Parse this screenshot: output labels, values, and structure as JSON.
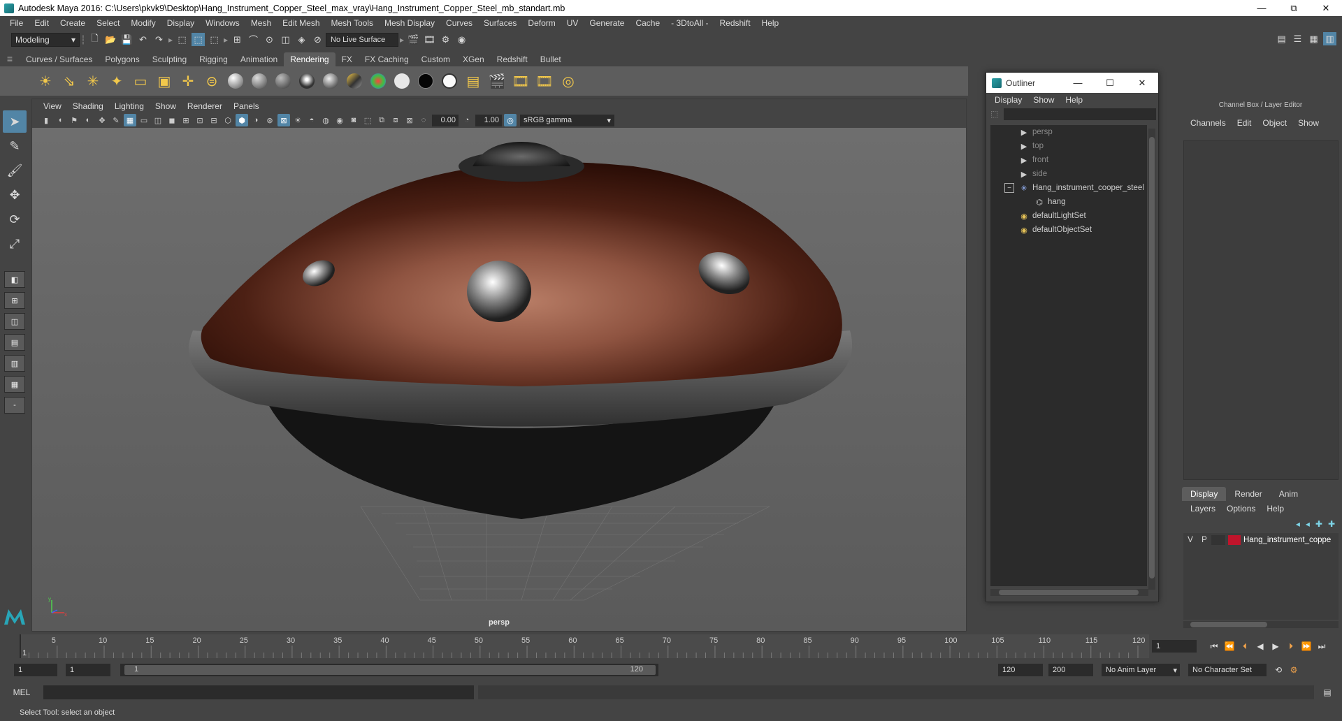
{
  "window": {
    "title": "Autodesk Maya 2016: C:\\Users\\pkvk9\\Desktop\\Hang_Instrument_Copper_Steel_max_vray\\Hang_Instrument_Copper_Steel_mb_standart.mb",
    "minimize_glyph": "—",
    "maximize_glyph": "⧉",
    "close_glyph": "✕"
  },
  "main_menu": [
    "File",
    "Edit",
    "Create",
    "Select",
    "Modify",
    "Display",
    "Windows",
    "Mesh",
    "Edit Mesh",
    "Mesh Tools",
    "Mesh Display",
    "Curves",
    "Surfaces",
    "Deform",
    "UV",
    "Generate",
    "Cache",
    "- 3DtoAll -",
    "Redshift",
    "Help"
  ],
  "status_line": {
    "mode": "Modeling",
    "live_surface": "No Live Surface"
  },
  "shelf": {
    "tabs": [
      "Curves / Surfaces",
      "Polygons",
      "Sculpting",
      "Rigging",
      "Animation",
      "Rendering",
      "FX",
      "FX Caching",
      "Custom",
      "XGen",
      "Redshift",
      "Bullet"
    ],
    "active_tab": "Rendering"
  },
  "viewport": {
    "menu": [
      "View",
      "Shading",
      "Lighting",
      "Show",
      "Renderer",
      "Panels"
    ],
    "exposure": "0.00",
    "gamma_value": "1.00",
    "color_space": "sRGB gamma",
    "camera_label": "persp",
    "axis_y": "y",
    "axis_x": "x"
  },
  "outliner": {
    "title": "Outliner",
    "menu": [
      "Display",
      "Show",
      "Help"
    ],
    "items": [
      {
        "label": "persp",
        "icon": "camera-icon",
        "dim": true,
        "indent": 1
      },
      {
        "label": "top",
        "icon": "camera-icon",
        "dim": true,
        "indent": 1
      },
      {
        "label": "front",
        "icon": "camera-icon",
        "dim": true,
        "indent": 1
      },
      {
        "label": "side",
        "icon": "camera-icon",
        "dim": true,
        "indent": 1
      },
      {
        "label": "Hang_instrument_cooper_steel",
        "icon": "group-icon",
        "dim": false,
        "indent": 1,
        "expander": "−"
      },
      {
        "label": "hang",
        "icon": "mesh-icon",
        "dim": false,
        "indent": 2
      },
      {
        "label": "defaultLightSet",
        "icon": "set-icon",
        "dim": false,
        "indent": 1
      },
      {
        "label": "defaultObjectSet",
        "icon": "set-icon",
        "dim": false,
        "indent": 1
      }
    ]
  },
  "channel_box": {
    "title": "Channel Box / Layer Editor",
    "menu": [
      "Channels",
      "Edit",
      "Object",
      "Show"
    ],
    "layer_tabs": [
      "Display",
      "Render",
      "Anim"
    ],
    "active_layer_tab": "Display",
    "layer_menu": [
      "Layers",
      "Options",
      "Help"
    ],
    "layers": [
      {
        "v": "V",
        "p": "P",
        "name": "Hang_instrument_coppe",
        "color": "#c0142b"
      }
    ]
  },
  "timeline": {
    "start_label": "1",
    "ticks": [
      5,
      10,
      15,
      20,
      25,
      30,
      35,
      40,
      45,
      50,
      55,
      60,
      65,
      70,
      75,
      80,
      85,
      90,
      95,
      100,
      105,
      110,
      115,
      120
    ],
    "min": 1,
    "max": 120,
    "current_frame": "1"
  },
  "range": {
    "start": "1",
    "playback_start": "1",
    "slider_start": "1",
    "slider_end": "120",
    "playback_end": "120",
    "end": "200",
    "anim_layer": "No Anim Layer",
    "character_set": "No Character Set"
  },
  "command_line": {
    "language": "MEL"
  },
  "help_line": "Select Tool: select an object",
  "colors": {
    "accent": "#5285a6",
    "copper": "#8a4a34",
    "layer_red": "#c0142b"
  }
}
